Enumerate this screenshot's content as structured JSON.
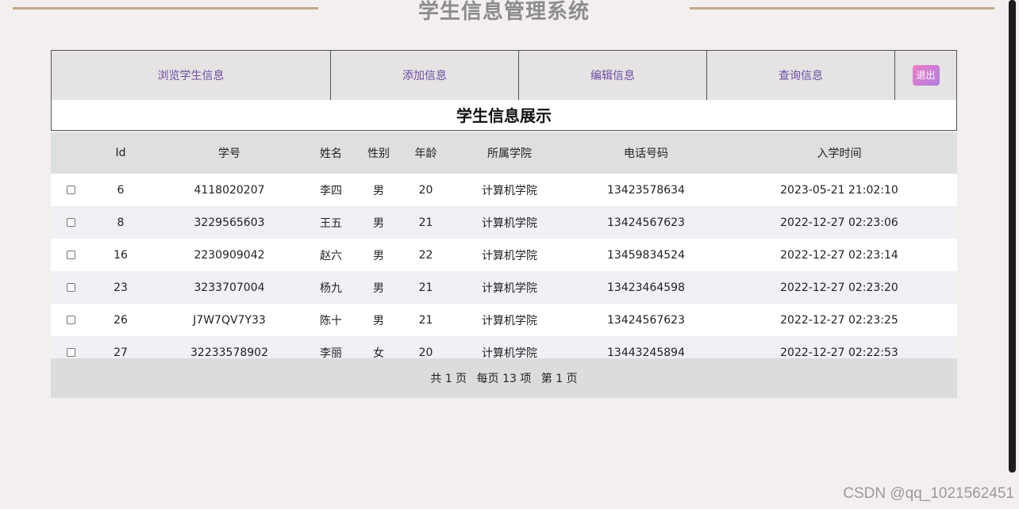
{
  "app": {
    "title": "学生信息管理系统"
  },
  "nav": {
    "items": [
      {
        "label": "浏览学生信息"
      },
      {
        "label": "添加信息"
      },
      {
        "label": "编辑信息"
      },
      {
        "label": "查询信息"
      }
    ],
    "logout_label": "退出"
  },
  "table": {
    "caption": "学生信息展示",
    "headers": [
      "",
      "Id",
      "学号",
      "姓名",
      "性别",
      "年龄",
      "所属学院",
      "电话号码",
      "入学时间"
    ],
    "rows": [
      {
        "id": "6",
        "student_no": "4118020207",
        "name": "李四",
        "gender": "男",
        "age": "20",
        "college": "计算机学院",
        "phone": "13423578634",
        "enroll_time": "2023-05-21 21:02:10"
      },
      {
        "id": "8",
        "student_no": "3229565603",
        "name": "王五",
        "gender": "男",
        "age": "21",
        "college": "计算机学院",
        "phone": "13424567623",
        "enroll_time": "2022-12-27 02:23:06"
      },
      {
        "id": "16",
        "student_no": "2230909042",
        "name": "赵六",
        "gender": "男",
        "age": "22",
        "college": "计算机学院",
        "phone": "13459834524",
        "enroll_time": "2022-12-27 02:23:14"
      },
      {
        "id": "23",
        "student_no": "3233707004",
        "name": "杨九",
        "gender": "男",
        "age": "21",
        "college": "计算机学院",
        "phone": "13423464598",
        "enroll_time": "2022-12-27 02:23:20"
      },
      {
        "id": "26",
        "student_no": "J7W7QV7Y33",
        "name": "陈十",
        "gender": "男",
        "age": "21",
        "college": "计算机学院",
        "phone": "13424567623",
        "enroll_time": "2022-12-27 02:23:25"
      },
      {
        "id": "27",
        "student_no": "32233578902",
        "name": "李丽",
        "gender": "女",
        "age": "20",
        "college": "计算机学院",
        "phone": "13443245894",
        "enroll_time": "2022-12-27 02:22:53"
      }
    ]
  },
  "pagination": {
    "total_pages": "共 1 页",
    "per_page": "每页 13 项",
    "current_page": "第 1 页"
  },
  "watermark": "CSDN @qq_1021562451",
  "colors": {
    "background": "#f3efee",
    "title_line": "#c3a887",
    "nav_text": "#6a4ea3",
    "logout_gradient_start": "#ec7fc7",
    "logout_gradient_end": "#b07de0",
    "header_bg": "#dedfe1"
  }
}
